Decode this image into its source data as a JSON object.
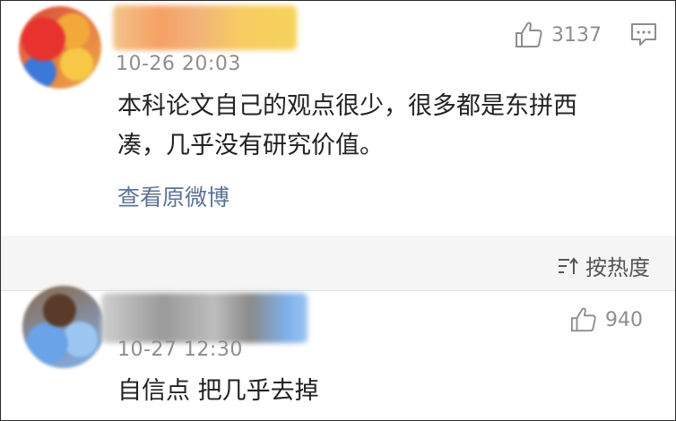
{
  "comment1": {
    "timestamp": "10-26 20:03",
    "text_line1": "本科论文自己的观点很少，很多都是东拼西",
    "text_line2": "凑，几乎没有研究价值。",
    "likes": "3137",
    "like_icon": "thumbs-up-icon",
    "reply_icon": "comment-icon",
    "view_link": "查看原微博"
  },
  "sort": {
    "label": "按热度",
    "icon": "sort-icon"
  },
  "comment2": {
    "timestamp": "10-27 12:30",
    "text": "自信点 把几乎去掉",
    "likes": "940",
    "like_icon": "thumbs-up-icon"
  }
}
